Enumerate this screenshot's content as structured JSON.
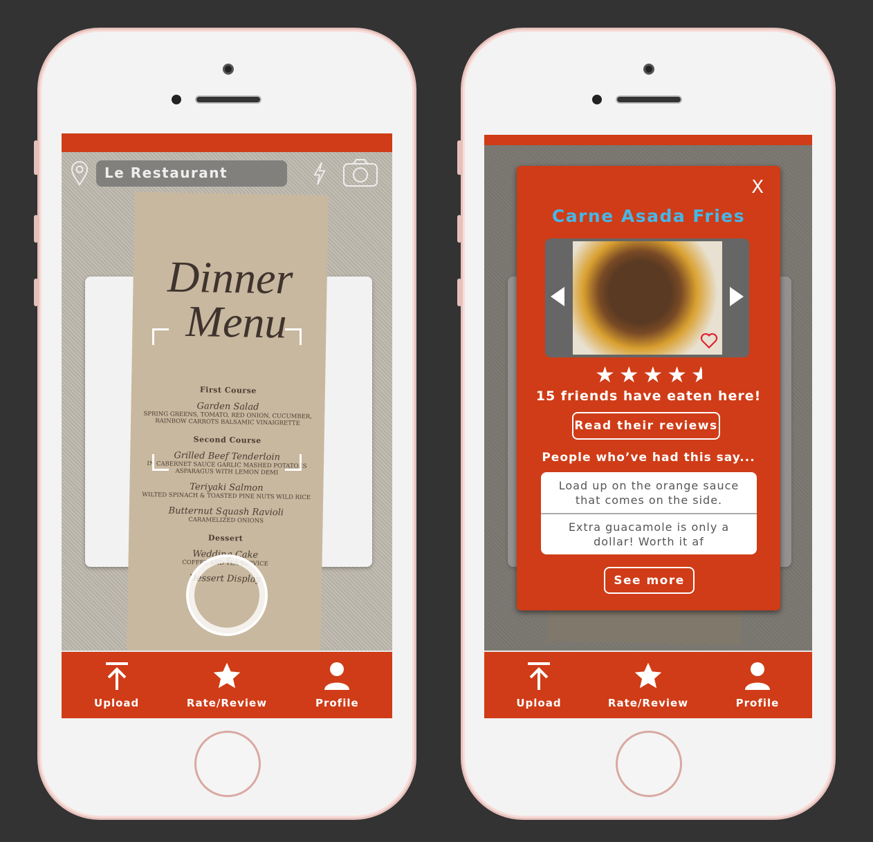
{
  "colors": {
    "brand": "#cf3c17",
    "title_blue": "#46b7e8"
  },
  "nav": [
    {
      "label": "Upload",
      "icon": "upload-icon"
    },
    {
      "label": "Rate/Review",
      "icon": "star-icon"
    },
    {
      "label": "Profile",
      "icon": "profile-icon"
    }
  ],
  "scanner": {
    "restaurant": "Le Restaurant",
    "menu": {
      "title_line1": "Dinner",
      "title_line2": "Menu",
      "first_course": "First Course",
      "dish1": "Garden Salad",
      "dish1_desc": "Spring Greens, Tomato, Red Onion, Cucumber, Rainbow Carrots Balsamic Vinaigrette",
      "second_course": "Second Course",
      "dish2": "Grilled Beef Tenderloin",
      "dish2_desc": "In Cabernet Sauce Garlic Mashed Potatoes Asparagus with Lemon Demi",
      "dish3": "Teriyaki Salmon",
      "dish3_desc": "Wilted Spinach & Toasted Pine Nuts Wild Rice",
      "dish4": "Butternut Squash Ravioli",
      "dish4_desc": "Caramelized Onions",
      "dessert": "Dessert",
      "dish5": "Wedding Cake",
      "dish5_desc": "Coffee and Tea Service",
      "dish6": "Dessert Display"
    }
  },
  "popup": {
    "close": "X",
    "title": "Carne Asada Fries",
    "rating": 4.5,
    "stars": "★★★★",
    "half_star": "★",
    "friends": "15 friends have eaten here!",
    "read_reviews": "Read their reviews",
    "say_heading": "People who’ve had this say...",
    "reviews": [
      "Load up on the orange sauce that comes on the side.",
      "Extra guacamole is only a dollar! Worth it af"
    ],
    "see_more": "See more"
  }
}
